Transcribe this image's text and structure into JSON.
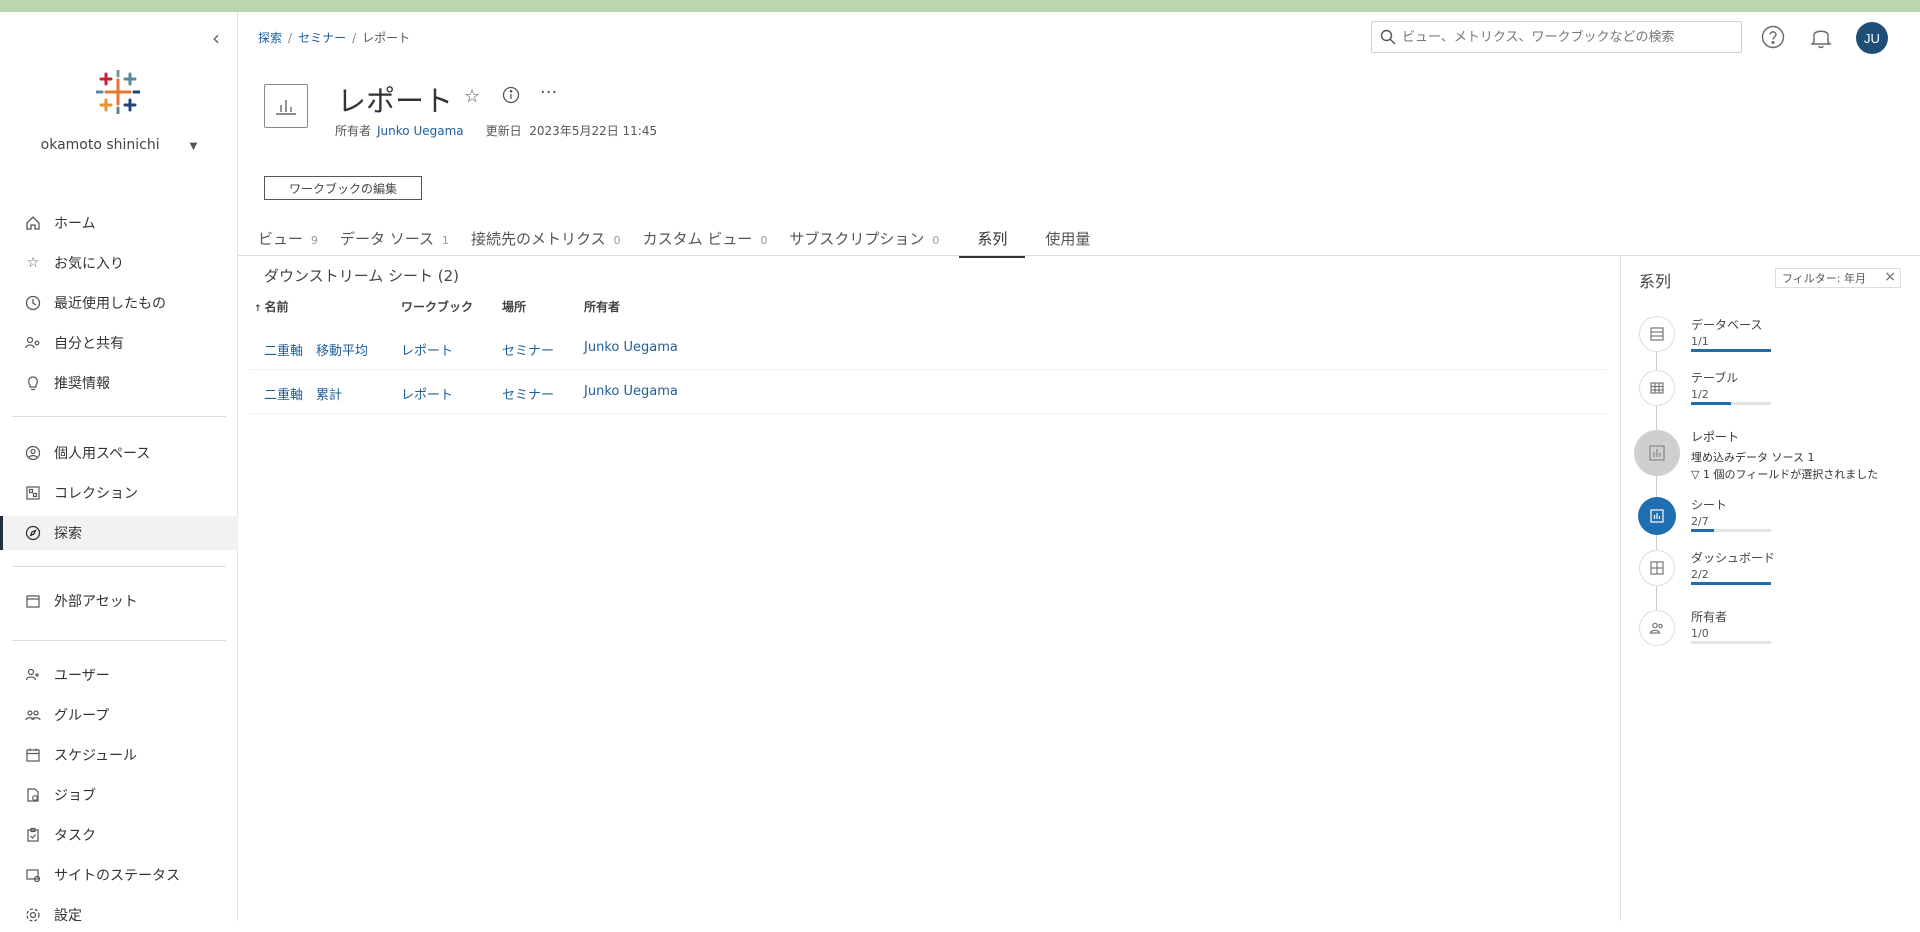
{
  "sidebar": {
    "user_name": "okamoto shinichi",
    "items": [
      {
        "label": "ホーム",
        "icon": "home-icon"
      },
      {
        "label": "お気に入り",
        "icon": "star-icon"
      },
      {
        "label": "最近使用したもの",
        "icon": "clock-icon"
      },
      {
        "label": "自分と共有",
        "icon": "share-icon"
      },
      {
        "label": "推奨情報",
        "icon": "lightbulb-icon"
      },
      {
        "label": "個人用スペース",
        "icon": "person-icon"
      },
      {
        "label": "コレクション",
        "icon": "collection-icon"
      },
      {
        "label": "探索",
        "icon": "compass-icon"
      },
      {
        "label": "外部アセット",
        "icon": "external-assets-icon"
      },
      {
        "label": "ユーザー",
        "icon": "user-icon"
      },
      {
        "label": "グループ",
        "icon": "group-icon"
      },
      {
        "label": "スケジュール",
        "icon": "calendar-icon"
      },
      {
        "label": "ジョブ",
        "icon": "job-icon"
      },
      {
        "label": "タスク",
        "icon": "task-icon"
      },
      {
        "label": "サイトのステータス",
        "icon": "status-icon"
      },
      {
        "label": "設定",
        "icon": "gear-icon"
      }
    ]
  },
  "breadcrumb": [
    "探索",
    "セミナー",
    "レポート"
  ],
  "search": {
    "placeholder": "ビュー、メトリクス、ワークブックなどの検索"
  },
  "user_initials": "JU",
  "workbook": {
    "title": "レポート",
    "owner_label": "所有者",
    "owner": "Junko Uegama",
    "updated_label": "更新日",
    "updated": "2023年5月22日 11:45",
    "edit_button": "ワークブックの編集"
  },
  "tabs": [
    {
      "label": "ビュー",
      "count": "9"
    },
    {
      "label": "データ ソース",
      "count": "1"
    },
    {
      "label": "接続先のメトリクス",
      "count": "0"
    },
    {
      "label": "カスタム ビュー",
      "count": "0"
    },
    {
      "label": "サブスクリプション",
      "count": "0"
    },
    {
      "label": "系列",
      "count": ""
    },
    {
      "label": "使用量",
      "count": ""
    }
  ],
  "table": {
    "title": "ダウンストリーム シート (2)",
    "sort_indicator": "↑",
    "headers": [
      "名前",
      "ワークブック",
      "場所",
      "所有者"
    ],
    "rows": [
      [
        "二重軸　移動平均",
        "レポート",
        "セミナー",
        "Junko Uegama"
      ],
      [
        "二重軸　累計",
        "レポート",
        "セミナー",
        "Junko Uegama"
      ]
    ]
  },
  "lineage": {
    "title": "系列",
    "filter_label": "フィルター: 年月",
    "close": "×",
    "nodes": [
      {
        "label": "データベース",
        "count": "1/1",
        "fill": 1.0
      },
      {
        "label": "テーブル",
        "count": "1/2",
        "fill": 0.5
      },
      {
        "label": "レポート",
        "sub1": "埋め込みデータ ソース 1",
        "sub2": "▽ 1 個のフィールドが選択されました"
      },
      {
        "label": "シート",
        "count": "2/7",
        "fill": 0.286
      },
      {
        "label": "ダッシュボード",
        "count": "2/2",
        "fill": 1.0
      },
      {
        "label": "所有者",
        "count": "1/0",
        "fill": 0.0
      }
    ]
  },
  "colors": {
    "accent": "#1f6fb0",
    "avatar": "#1f4e79",
    "link": "#1f5f99"
  }
}
